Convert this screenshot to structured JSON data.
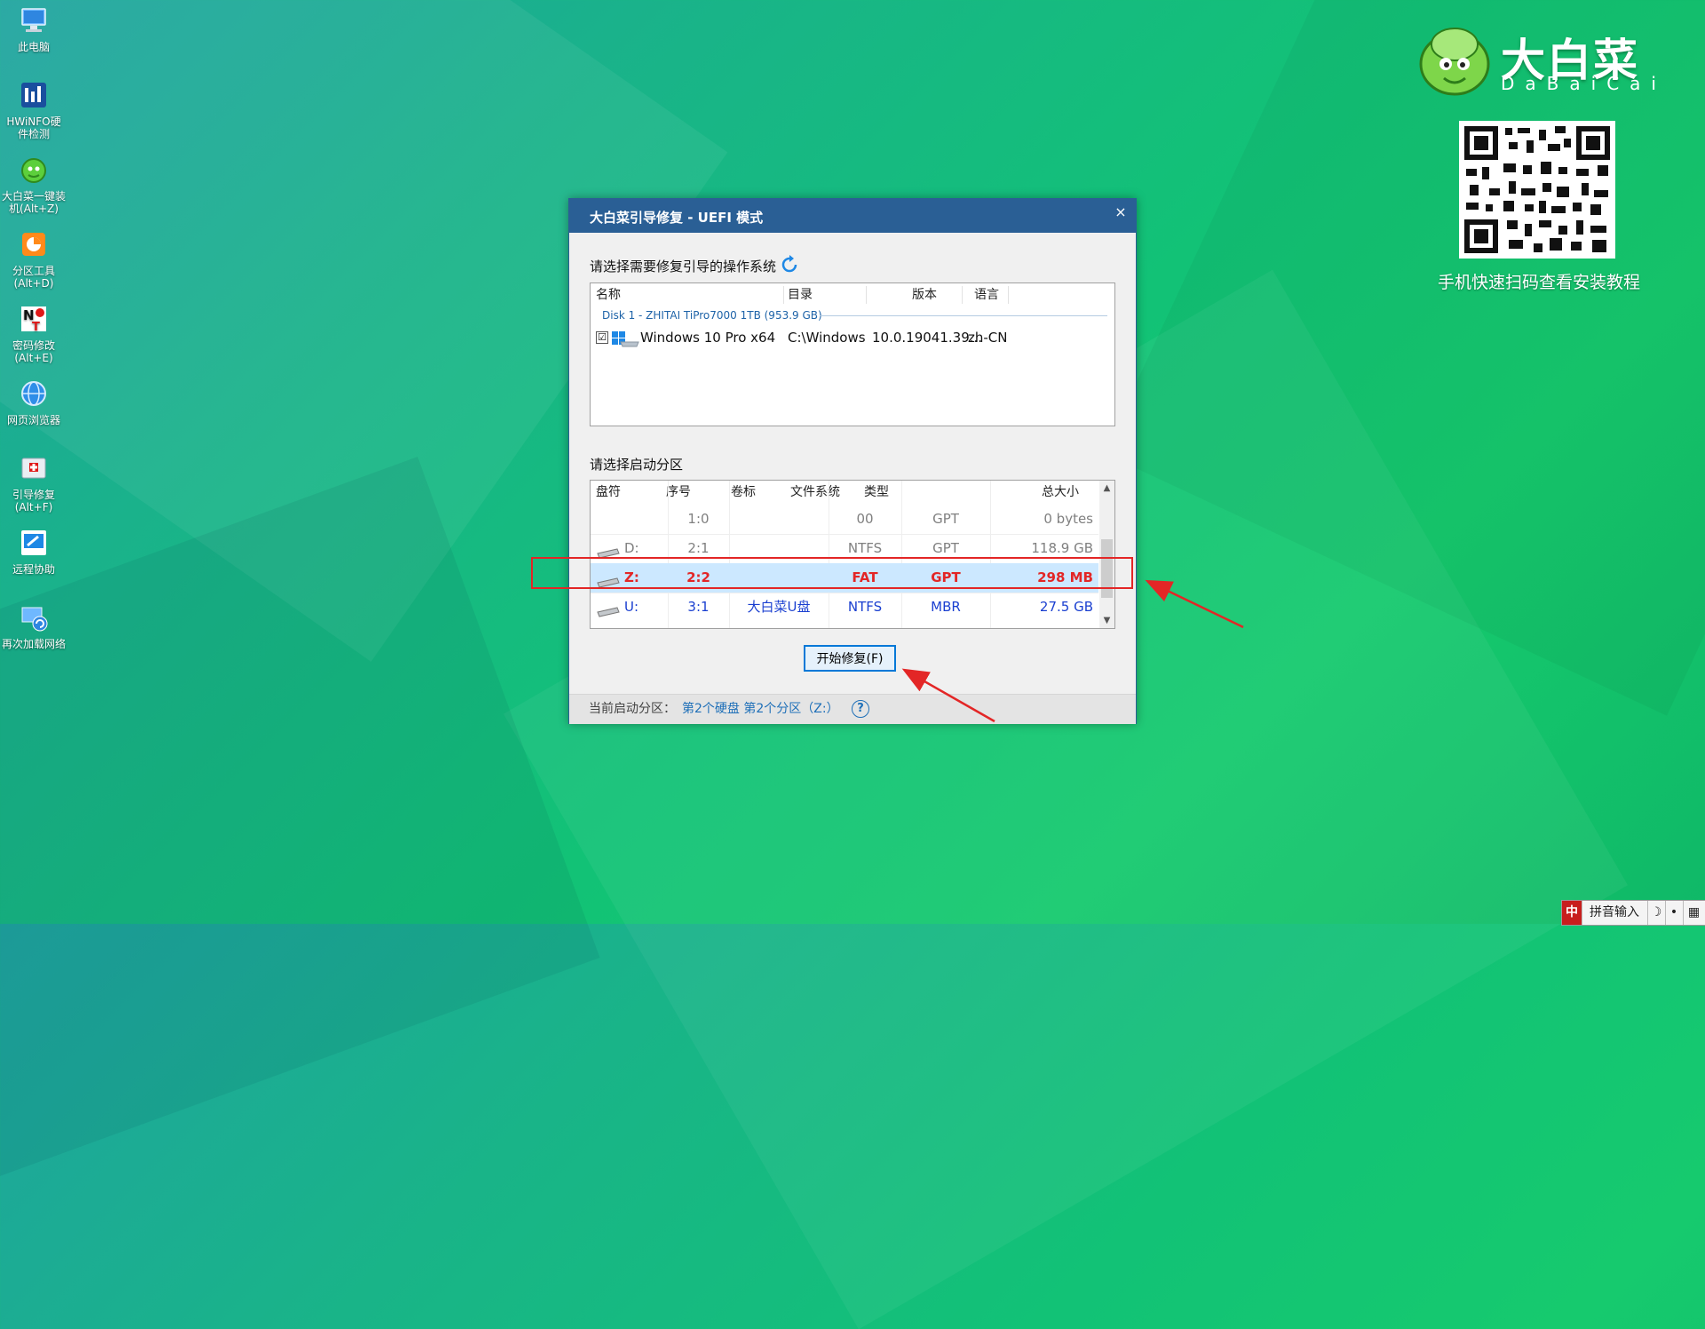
{
  "desktop": {
    "icons": [
      {
        "label": "此电脑",
        "icon": "computer-icon"
      },
      {
        "label": "HWiNFO硬\n件检测",
        "icon": "hwinfo-icon"
      },
      {
        "label": "大白菜一键装\n机(Alt+Z)",
        "icon": "dabaicai-install-icon"
      },
      {
        "label": "分区工具\n(Alt+D)",
        "icon": "partition-tool-icon"
      },
      {
        "label": "密码修改\n(Alt+E)",
        "icon": "password-edit-icon"
      },
      {
        "label": "网页浏览器",
        "icon": "browser-icon"
      },
      {
        "label": "引导修复\n(Alt+F)",
        "icon": "boot-repair-icon"
      },
      {
        "label": "远程协助",
        "icon": "remote-assist-icon"
      },
      {
        "label": "再次加载网络",
        "icon": "reload-network-icon"
      }
    ]
  },
  "branding": {
    "logo_text": "大白菜",
    "logo_sub": "DaBaiCai",
    "qr_caption": "手机快速扫码查看安装教程"
  },
  "dialog": {
    "title": "大白菜引导修复 - UEFI 模式",
    "close_label": "×",
    "os_section_label": "请选择需要修复引导的操作系统",
    "os_columns": [
      "名称",
      "目录",
      "版本",
      "语言"
    ],
    "disk_group": "Disk 1 - ZHITAI TiPro7000 1TB (953.9 GB)",
    "os_rows": [
      {
        "checked": "☑",
        "name": "Windows 10 Pro x64",
        "dir": "C:\\Windows",
        "version": "10.0.19041.39...",
        "lang": "zh-CN"
      }
    ],
    "partition_section_label": "请选择启动分区",
    "partition_columns": [
      "盘符",
      "序号",
      "卷标",
      "文件系统",
      "类型",
      "总大小"
    ],
    "partitions": [
      {
        "drive": "",
        "index": "1:0",
        "label": "",
        "fs": "00",
        "type": "GPT",
        "size": "0 bytes",
        "color": "#808080"
      },
      {
        "drive": "D:",
        "index": "2:1",
        "label": "",
        "fs": "NTFS",
        "type": "GPT",
        "size": "118.9 GB",
        "color": "#808080"
      },
      {
        "drive": "Z:",
        "index": "2:2",
        "label": "",
        "fs": "FAT",
        "type": "GPT",
        "size": "298 MB",
        "color": "#e32626"
      },
      {
        "drive": "U:",
        "index": "3:1",
        "label": "大白菜U盘",
        "fs": "NTFS",
        "type": "MBR",
        "size": "27.5 GB",
        "color": "#1a3fd0"
      }
    ],
    "fix_button": "开始修复(F)",
    "status_prefix": "当前启动分区：",
    "status_value": "第2个硬盘 第2个分区（Z:）",
    "help_label": "?"
  },
  "ime": {
    "label": "拼音输入",
    "moon": "☽",
    "dot": "•",
    "keyboard": "▦"
  },
  "colors": {
    "titlebar": "#2a5f95",
    "selected_row": "#cce8ff",
    "highlight_box": "#e32626",
    "arrow": "#e32626"
  }
}
